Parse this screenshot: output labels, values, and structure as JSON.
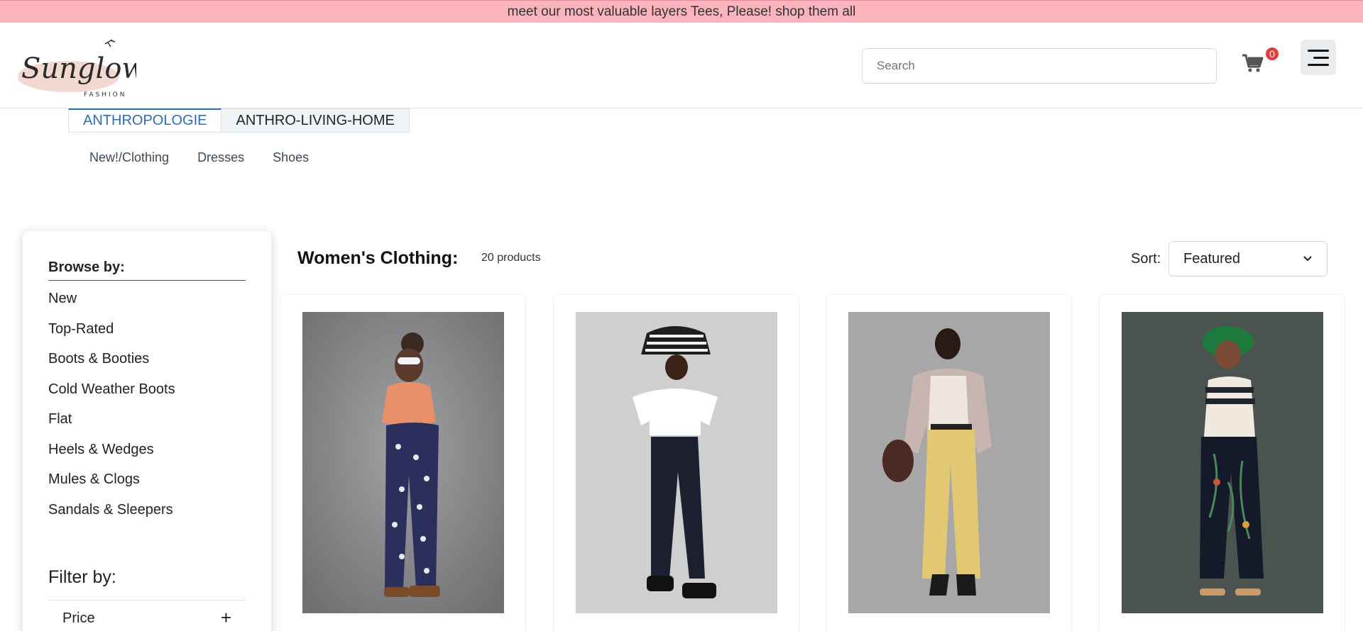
{
  "promo": {
    "text": "meet our most valuable layers Tees, Please! shop them all"
  },
  "header": {
    "logo": {
      "name": "Sunglow",
      "tagline": "FASHION"
    },
    "search_placeholder": "Search",
    "cart_count": "0"
  },
  "tabs": [
    {
      "label": "ANTHROPOLOGIE",
      "active": true
    },
    {
      "label": "ANTHRO-LIVING-HOME",
      "active": false
    }
  ],
  "subnav": [
    "New!/Clothing",
    "Dresses",
    "Shoes"
  ],
  "sidebar": {
    "browse_title": "Browse by:",
    "browse_items": [
      "New",
      "Top-Rated",
      "Boots & Booties",
      "Cold Weather Boots",
      "Flat",
      "Heels & Wedges",
      "Mules & Clogs",
      "Sandals & Sleepers"
    ],
    "filter_title": "Filter by:",
    "filters": [
      {
        "label": "Price",
        "toggle": "+"
      }
    ]
  },
  "main": {
    "title": "Women's Clothing:",
    "count": "20 products",
    "sort_label": "Sort:",
    "sort_value": "Featured"
  },
  "products": [
    {
      "image": "model in orange knit top and navy floral wide-leg pants"
    },
    {
      "image": "model in white flutter top, striped bucket hat and navy pants"
    },
    {
      "image": "model in cream top, plaid shacket and yellow wide-leg pants"
    },
    {
      "image": "model in striped knit tank, green hat and floral navy pants"
    }
  ],
  "colors": {
    "promo_bg": "#fbb3bd",
    "accent": "#2f6db5",
    "badge": "#e23d3d"
  }
}
